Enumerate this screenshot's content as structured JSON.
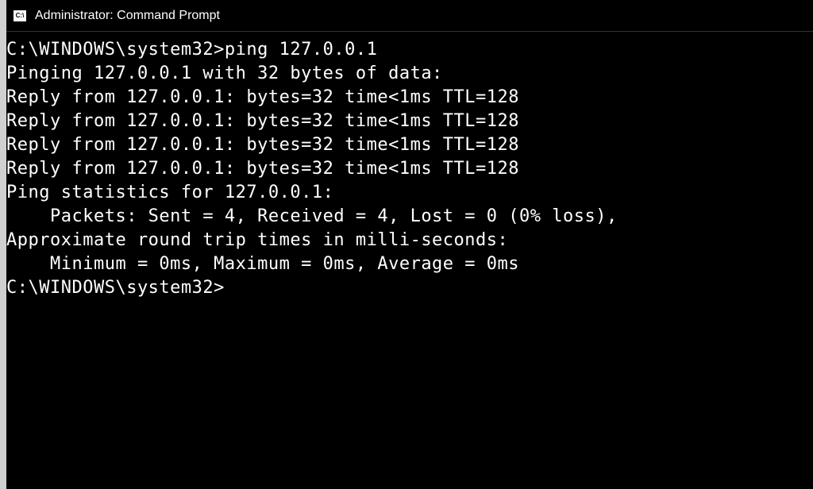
{
  "titlebar": {
    "icon_label": "C:\\",
    "title": "Administrator: Command Prompt"
  },
  "terminal": {
    "lines": {
      "blank_top": "",
      "cmd_line": "C:\\WINDOWS\\system32>ping 127.0.0.1",
      "blank_after_cmd": "",
      "pinging": "Pinging 127.0.0.1 with 32 bytes of data:",
      "reply1": "Reply from 127.0.0.1: bytes=32 time<1ms TTL=128",
      "reply2": "Reply from 127.0.0.1: bytes=32 time<1ms TTL=128",
      "reply3": "Reply from 127.0.0.1: bytes=32 time<1ms TTL=128",
      "reply4": "Reply from 127.0.0.1: bytes=32 time<1ms TTL=128",
      "blank_after_replies": "",
      "stats_header": "Ping statistics for 127.0.0.1:",
      "packets": "    Packets: Sent = 4, Received = 4, Lost = 0 (0% loss),",
      "rtt_header": "Approximate round trip times in milli-seconds:",
      "rtt_values": "    Minimum = 0ms, Maximum = 0ms, Average = 0ms",
      "blank_after_stats": "",
      "prompt2": "C:\\WINDOWS\\system32>"
    }
  }
}
